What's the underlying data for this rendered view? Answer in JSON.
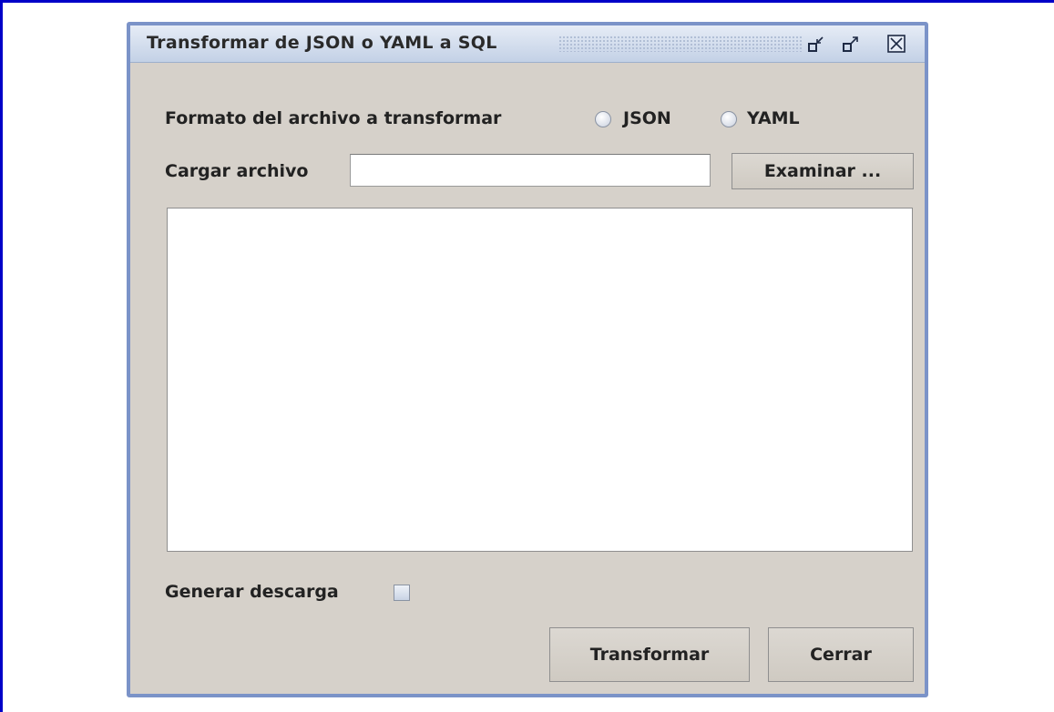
{
  "window": {
    "title": "Transformar de JSON o YAML a SQL",
    "controls": {
      "restore_icon": "restore-icon",
      "maximize_icon": "maximize-icon",
      "close_icon": "close-icon"
    }
  },
  "format": {
    "label": "Formato del archivo a transformar",
    "options": [
      {
        "label": "JSON",
        "selected": false
      },
      {
        "label": "YAML",
        "selected": false
      }
    ]
  },
  "file": {
    "label": "Cargar archivo",
    "value": "",
    "browse_label": "Examinar ..."
  },
  "output": {
    "value": ""
  },
  "download": {
    "label": "Generar descarga",
    "checked": false
  },
  "actions": {
    "transform_label": "Transformar",
    "close_label": "Cerrar"
  },
  "colors": {
    "frame_border": "#0000c8",
    "window_border": "#7b93c8",
    "window_bg": "#d6d1ca"
  }
}
